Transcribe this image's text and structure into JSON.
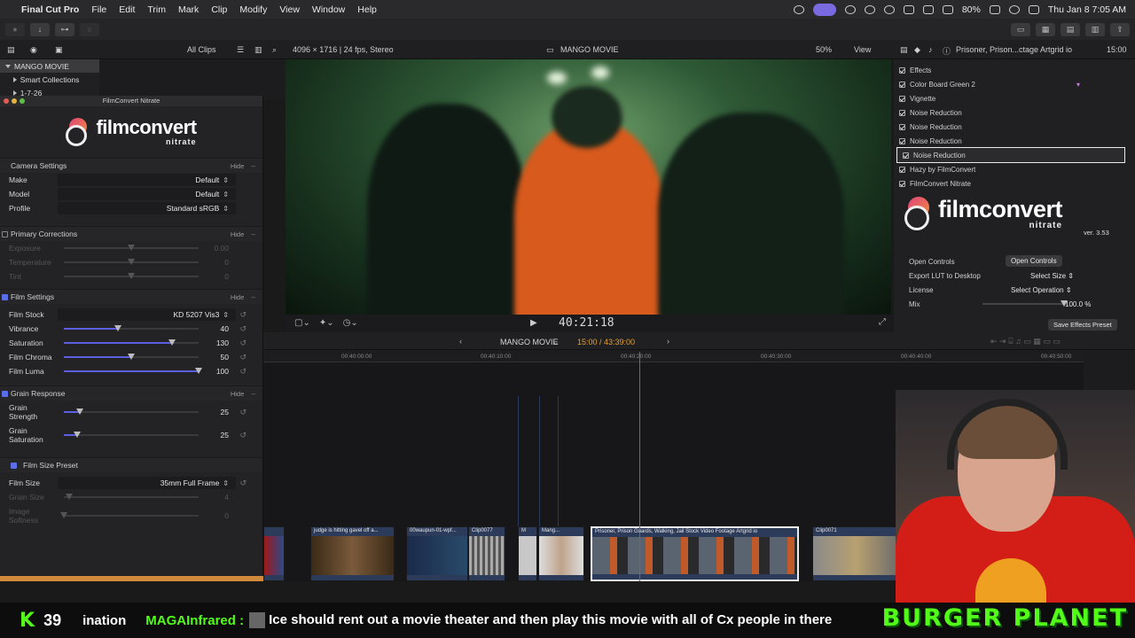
{
  "menubar": {
    "app": "Final Cut Pro",
    "items": [
      "File",
      "Edit",
      "Trim",
      "Mark",
      "Clip",
      "Modify",
      "View",
      "Window",
      "Help"
    ],
    "battery": "80%",
    "datetime": "Thu Jan 8  7:05 AM"
  },
  "browser": {
    "filter": "All Clips",
    "library": "MANGO MOVIE",
    "smart_collections": "Smart Collections",
    "event": "1-7-26"
  },
  "viewer": {
    "format": "4096 × 1716 | 24 fps, Stereo",
    "project": "MANGO MOVIE",
    "zoom": "50%",
    "view_menu": "View",
    "timecode": "40:21:18"
  },
  "plugin": {
    "window_title": "FilmConvert Nitrate",
    "logo_main": "filmconvert",
    "logo_sub": "nitrate",
    "hide_label": "Hide",
    "camera_settings": "Camera Settings",
    "make_label": "Make",
    "make_value": "Default",
    "model_label": "Model",
    "model_value": "Default",
    "profile_label": "Profile",
    "profile_value": "Standard sRGB",
    "primary_corrections": "Primary Corrections",
    "exposure": "Exposure",
    "exposure_val": "0.00",
    "temperature": "Temperature",
    "temperature_val": "0",
    "tint": "Tint",
    "tint_val": "0",
    "film_settings": "Film Settings",
    "film_stock_label": "Film Stock",
    "film_stock_value": "KD 5207 Vis3",
    "vibrance": "Vibrance",
    "vibrance_val": "40",
    "saturation": "Saturation",
    "saturation_val": "130",
    "film_chroma": "Film Chroma",
    "film_chroma_val": "50",
    "film_luma": "Film Luma",
    "film_luma_val": "100",
    "grain_response": "Grain Response",
    "grain_strength": "Grain Strength",
    "grain_strength_val": "25",
    "grain_saturation": "Grain Saturation",
    "grain_saturation_val": "25",
    "film_size_preset": "Film Size Preset",
    "film_size_label": "Film Size",
    "film_size_value": "35mm Full Frame",
    "grain_size": "Grain Size",
    "grain_size_val": "4",
    "image_softness": "Image Softness",
    "image_softness_val": "0"
  },
  "slider_levels": {
    "vibrance": 0.4,
    "saturation": 0.8,
    "film_chroma": 0.5,
    "film_luma": 1.0,
    "grain_strength": 0.12,
    "grain_saturation": 0.1
  },
  "inspector": {
    "clip_name": "Prisoner, Prison...ctage  Artgrid io",
    "duration": "15:00",
    "effects_header": "Effects",
    "effects": [
      "Color Board Green 2",
      "Vignette",
      "Noise Reduction",
      "Noise Reduction",
      "Noise Reduction",
      "Noise Reduction",
      "Hazy by FilmConvert",
      "FilmConvert Nitrate"
    ],
    "version": "ver. 3.53",
    "open_controls_label": "Open Controls",
    "open_controls_btn": "Open Controls",
    "export_lut_label": "Export LUT to Desktop",
    "export_lut_value": "Select Size",
    "license_label": "License",
    "license_value": "Select Operation",
    "mix_label": "Mix",
    "mix_value": "100.0 %",
    "save_preset": "Save Effects Preset"
  },
  "timeline": {
    "project": "MANGO MOVIE",
    "position": "15:00 / 43:39:00",
    "ticks": [
      "00:40:00:00",
      "00:40:10:00",
      "00:40:20:00",
      "00:40:30:00",
      "00:40:40:00",
      "00:40:50:00"
    ],
    "clips": [
      {
        "label": "judge is hitting gavel off a..."
      },
      {
        "label": "00waupun-01-wpf..."
      },
      {
        "label": "Clip0077"
      },
      {
        "label": "M"
      },
      {
        "label": "Mang..."
      },
      {
        "label": "Prisoner, Prison Guards, Walking, Jail  Stock Video Footage  Artgrid io"
      },
      {
        "label": "Clip0071"
      }
    ]
  },
  "chat": {
    "platform": "K",
    "viewers": "39",
    "ticker": "ination",
    "user": "MAGAInfrared :",
    "message": "Ice should rent out a movie theater and then play this movie with all of Cx people in there",
    "banner": "BURGER PLANET"
  },
  "colors": {
    "accent": "#5b6ee8",
    "playhead": "#e03a3a",
    "kick_green": "#53fc18"
  }
}
